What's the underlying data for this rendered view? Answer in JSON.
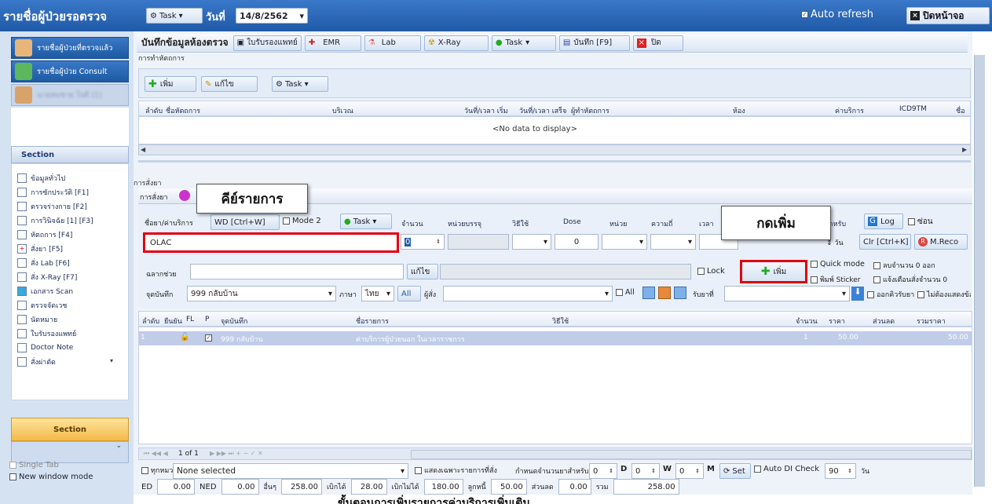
{
  "titlebar": {
    "title": "รายชื่อผู้ป่วยรอตรวจ",
    "task": "Task",
    "date_label": "วันที่",
    "date": "14/8/2562",
    "auto_refresh": "Auto refresh",
    "close_screen": "ปิดหน้าจอ"
  },
  "sidebar": {
    "nav": [
      "รายชื่อผู้ป่วยที่ตรวจแล้ว",
      "รายชื่อผู้ป่วย Consult",
      "นายสมชาย ใจดี (1)"
    ],
    "section_title": "Section",
    "items": [
      "ข้อมูลทั่วไป",
      "การซักประวัติ [F1]",
      "ตรวจร่างกาย [F2]",
      "การวินิจฉัย [1] [F3]",
      "หัตถการ [F4]",
      "สั่งยา [F5]",
      "สั่ง Lab [F6]",
      "สั่ง X-Ray [F7]",
      "เอกสาร Scan",
      "ตรวจจัดเวช",
      "นัดหมาย",
      "ใบรับรองแพทย์",
      "Doctor Note",
      "สั่งผ่าตัด"
    ],
    "section_footer": "Section",
    "single_tab": "Single Tab",
    "new_window": "New window mode"
  },
  "toolbar": {
    "title": "บันทึกข้อมูลห้องตรวจ",
    "cert": "ใบรับรองแพทย์",
    "emr": "EMR",
    "lab": "Lab",
    "xray": "X-Ray",
    "task": "Task",
    "save": "บันทึก [F9]",
    "close": "ปิด"
  },
  "proc": {
    "section": "การทำหัตถการ",
    "add": "เพิ่ม",
    "edit": "แก้ไข",
    "task": "Task",
    "cols": [
      "ลำดับ",
      "ชื่อหัตถการ",
      "บริเวณ",
      "วันที่/เวลา เริ่ม",
      "วันที่/เวลา เสร็จ",
      "ผู้ทำหัตถการ",
      "ห้อง",
      "ค่าบริการ",
      "ICD9TM",
      "ชื่อ"
    ],
    "empty": "<No data to display>"
  },
  "order": {
    "section": "การสั่งยา",
    "tab": "การสั่งยา",
    "label_name": "ชื่อยา/ค่าบริการ",
    "btn_wd": "WD [Ctrl+W]",
    "mode2": "Mode 2",
    "task": "Task",
    "cols": [
      "จำนวน",
      "หน่วยบรรจุ",
      "วิธีใช้",
      "Dose",
      "หน่วย",
      "ความถี่",
      "เวลา",
      "สำหรับ"
    ],
    "log": "Log",
    "hide": "ซ่อน",
    "item_value": "OLAC",
    "qty": "0",
    "dose": "0",
    "days_label": "วัน",
    "clr": "Clr [Ctrl+K]",
    "mreco": "M.Reco",
    "label_help": "ฉลากช่วย",
    "edit": "แก้ไข",
    "lock": "Lock",
    "add": "เพิ่ม",
    "quick_mode": "Quick mode",
    "del_zero": "ลบจำนวน 0 ออก",
    "print_sticker": "พิมพ์ Sticker",
    "warn_qty": "แจ้งเตือนสั่งจำนวน 0",
    "queue": "ออกคิวรับยา",
    "no_show": "ไม่ต้องแสดงข้อความแจ้ง",
    "label_point": "จุดบันทึก",
    "point_value": "999 กลับบ้าน",
    "lang_label": "ภาษา",
    "lang": "ไทย",
    "all": "All",
    "orderer": "ผู้สั่ง",
    "all2": "All",
    "receive_label": "รับยาที่"
  },
  "grid": {
    "cols": [
      "ลำดับ",
      "ยืนยัน",
      "FL",
      "P",
      "จุดบันทึก",
      "ชื่อรายการ",
      "วิธีใช้",
      "จำนวน",
      "ราคา",
      "ส่วนลด",
      "รวมราคา"
    ],
    "row": {
      "no": "1",
      "point": "999 กลับบ้าน",
      "name": "ค่าบริการผู้ป่วยนอก ในเวลาราชการ",
      "qty": "1",
      "price": "50.00",
      "total": "50.00"
    },
    "pager": "1 of 1"
  },
  "footer": {
    "all_cat": "ทุกหมวด",
    "none_selected": "None selected",
    "show_only": "แสดงเฉพาะรายการที่สั่ง",
    "set_qty": "กำหนดจำนวนยาสำหรับ",
    "d_val": "0",
    "d": "D",
    "w_val": "0",
    "w": "W",
    "m_val": "0",
    "m": "M",
    "set": "Set",
    "auto_di": "Auto DI Check",
    "auto_di_val": "90",
    "day": "วัน"
  },
  "totals": {
    "ed_label": "ED",
    "ed": "0.00",
    "ned_label": "NED",
    "ned": "0.00",
    "other_label": "อื่นๆ",
    "other": "258.00",
    "claim_label": "เบิกได้",
    "claim": "28.00",
    "noclaim_label": "เบิกไม่ได้",
    "noclaim": "180.00",
    "debt_label": "ลูกหนี้",
    "debt": "50.00",
    "disc_label": "ส่วนลด",
    "disc": "0.00",
    "sum_label": "รวม",
    "sum": "258.00"
  },
  "callouts": {
    "key_item": "คีย์รายการ",
    "press_add": "กดเพิ่ม"
  },
  "caption": "ขั้นตอนการเพิ่มรายการค่าบริการเพิ่มเติม"
}
